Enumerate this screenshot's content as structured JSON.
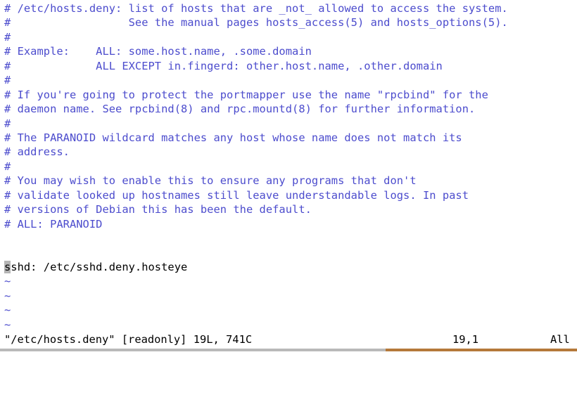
{
  "app": {
    "name": "vim",
    "mode": "readonly"
  },
  "colors": {
    "background": "#ffffff",
    "comment": "#4c4ccd",
    "code": "#000000",
    "cursor_block": "#b5b5b5",
    "rule_left": "#b9b9b9",
    "rule_right": "#b5793a"
  },
  "buffer": {
    "lines": [
      {
        "kind": "comment",
        "text": "# /etc/hosts.deny: list of hosts that are _not_ allowed to access the system."
      },
      {
        "kind": "comment",
        "text": "#                  See the manual pages hosts_access(5) and hosts_options(5)."
      },
      {
        "kind": "comment",
        "text": "#"
      },
      {
        "kind": "comment",
        "text": "# Example:    ALL: some.host.name, .some.domain"
      },
      {
        "kind": "comment",
        "text": "#             ALL EXCEPT in.fingerd: other.host.name, .other.domain"
      },
      {
        "kind": "comment",
        "text": "#"
      },
      {
        "kind": "comment",
        "text": "# If you're going to protect the portmapper use the name \"rpcbind\" for the"
      },
      {
        "kind": "comment",
        "text": "# daemon name. See rpcbind(8) and rpc.mountd(8) for further information."
      },
      {
        "kind": "comment",
        "text": "#"
      },
      {
        "kind": "comment",
        "text": "# The PARANOID wildcard matches any host whose name does not match its"
      },
      {
        "kind": "comment",
        "text": "# address."
      },
      {
        "kind": "comment",
        "text": "#"
      },
      {
        "kind": "comment",
        "text": "# You may wish to enable this to ensure any programs that don't"
      },
      {
        "kind": "comment",
        "text": "# validate looked up hostnames still leave understandable logs. In past"
      },
      {
        "kind": "comment",
        "text": "# versions of Debian this has been the default."
      },
      {
        "kind": "comment",
        "text": "# ALL: PARANOID"
      },
      {
        "kind": "blank",
        "text": ""
      },
      {
        "kind": "blank",
        "text": ""
      },
      {
        "kind": "code",
        "cursor_char": "s",
        "text": "shd: /etc/sshd.deny.hosteye"
      },
      {
        "kind": "tilde",
        "text": "~"
      },
      {
        "kind": "tilde",
        "text": "~"
      },
      {
        "kind": "tilde",
        "text": "~"
      },
      {
        "kind": "tilde",
        "text": "~"
      }
    ]
  },
  "status": {
    "file": "\"/etc/hosts.deny\" [readonly] 19L, 741C",
    "position": "19,1",
    "scroll": "All"
  }
}
